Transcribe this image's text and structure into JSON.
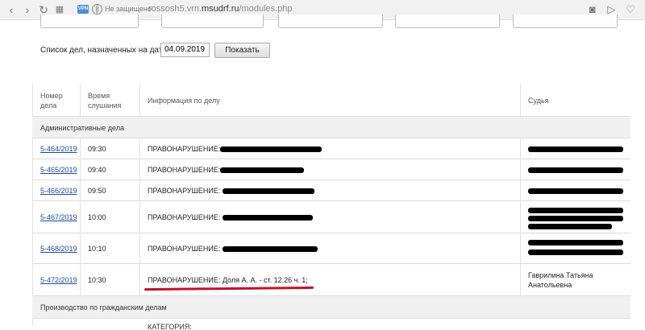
{
  "browser": {
    "vpn_label": "VPN",
    "security_text": "Не защищено",
    "url_host": "rossosh5.vrn.msudrf.ru",
    "url_prefix": "rossosh5.vrn.",
    "url_domain": "msudrf.ru",
    "url_path": "/modules.php"
  },
  "filter": {
    "label": "Список дел, назначенных на дату",
    "date": "04.09.2019",
    "button": "Показать"
  },
  "table": {
    "headers": {
      "number_line1": "Номер",
      "number_line2": "дела",
      "time_line1": "Время",
      "time_line2": "слушания",
      "info": "Информация по делу",
      "judge": "Судья"
    },
    "section_admin": "Административные дела",
    "rows": [
      {
        "number": "5-464/2019",
        "time": "09:30",
        "info": "ПРАВОНАРУШЕНИЕ:"
      },
      {
        "number": "5-465/2019",
        "time": "09:40",
        "info": "ПРАВОНАРУШЕНИЕ:"
      },
      {
        "number": "5-466/2019",
        "time": "09:50",
        "info": "ПРАВОНАРУШЕНИЕ:"
      },
      {
        "number": "5-467/2019",
        "time": "10:00",
        "info": "ПРАВОНАРУШЕНИЕ:"
      },
      {
        "number": "5-468/2019",
        "time": "10:10",
        "info": "ПРАВОНАРУШЕНИЕ:"
      },
      {
        "number": "5-472/2019",
        "time": "10:30",
        "info": "ПРАВОНАРУШЕНИЕ: Доля А. А. - ст. 12.26 ч. 1;",
        "judge_line1": "Гаврилина Татьяна",
        "judge_line2": "Анатольевна"
      }
    ],
    "section_civil": "Производство по гражданским делам",
    "civil_partial": "КАТЕГОРИЯ:"
  }
}
